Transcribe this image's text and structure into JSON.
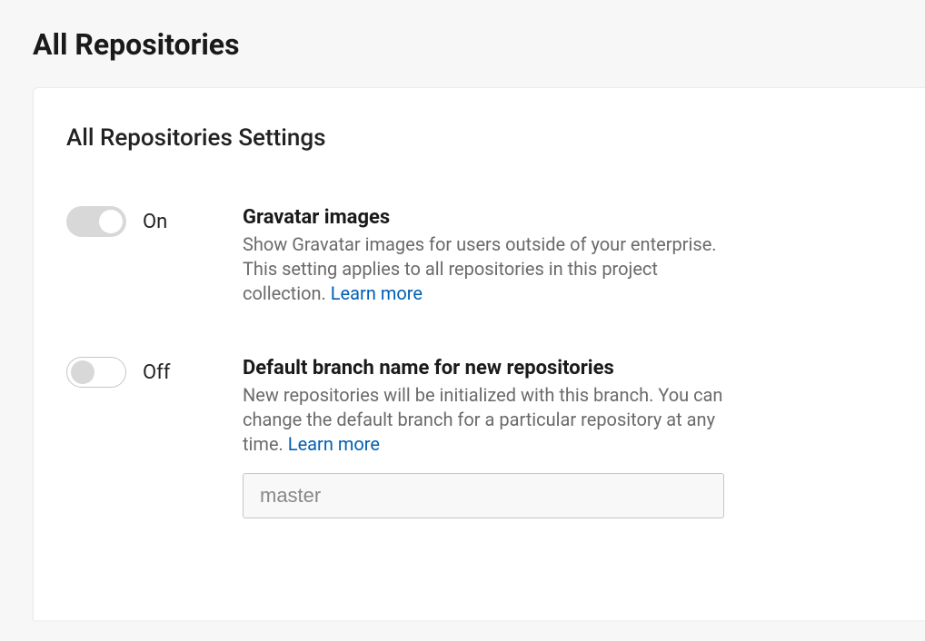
{
  "page": {
    "title": "All Repositories"
  },
  "card": {
    "title": "All Repositories Settings"
  },
  "settings": {
    "gravatar": {
      "toggle_state_label": "On",
      "title": "Gravatar images",
      "description": "Show Gravatar images for users outside of your enterprise. This setting applies to all repositories in this project collection. ",
      "learn_more": "Learn more"
    },
    "default_branch": {
      "toggle_state_label": "Off",
      "title": "Default branch name for new repositories",
      "description": "New repositories will be initialized with this branch. You can change the default branch for a particular repository at any time. ",
      "learn_more": "Learn more",
      "input_placeholder": "master",
      "input_value": ""
    }
  }
}
